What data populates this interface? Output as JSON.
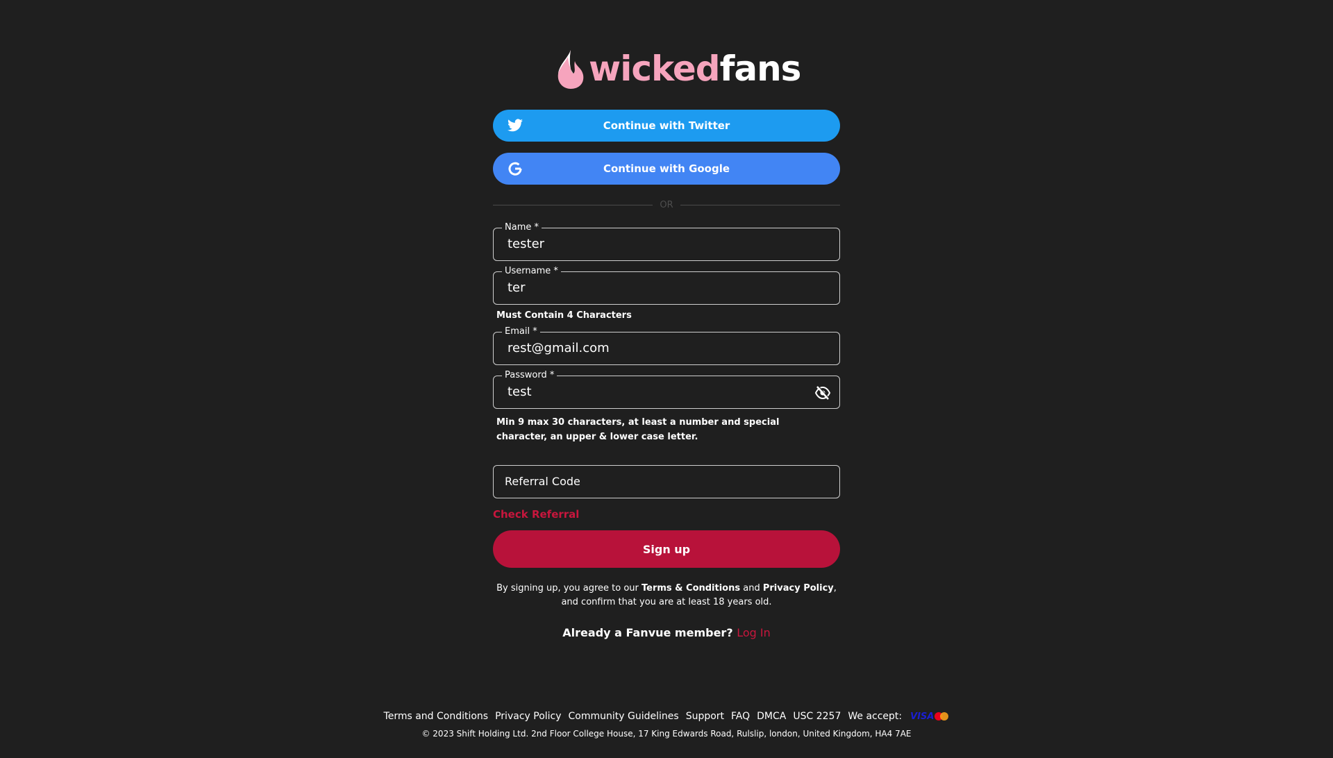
{
  "brand": {
    "name_part1": "wicked",
    "name_part2": "fans",
    "pink": "#f6a4bd"
  },
  "social": {
    "twitter_label": "Continue with Twitter",
    "google_label": "Continue with Google",
    "twitter_color": "#1d9bf0",
    "google_color": "#4285f4"
  },
  "divider_label": "OR",
  "fields": {
    "name": {
      "label": "Name *",
      "value": "tester"
    },
    "username": {
      "label": "Username *",
      "value": "ter",
      "helper": "Must Contain 4 Characters"
    },
    "email": {
      "label": "Email *",
      "value": "rest@gmail.com"
    },
    "password": {
      "label": "Password *",
      "value": "test",
      "helper": "Min 9 max 30 characters, at least a number and special character, an upper & lower case letter."
    },
    "referral": {
      "placeholder": "Referral Code"
    }
  },
  "check_referral": "Check Referral",
  "signup_label": "Sign up",
  "terms": {
    "prefix": "By signing up, you agree to our ",
    "terms_link": "Terms & Conditions",
    "and": " and ",
    "privacy_link": "Privacy Policy",
    "suffix": ", and confirm that you are at least 18 years old."
  },
  "already": {
    "text": "Already a Fanvue member?",
    "login": "Log In"
  },
  "footer": {
    "links": [
      "Terms and Conditions",
      "Privacy Policy",
      "Community Guidelines",
      "Support",
      "FAQ",
      "DMCA",
      "USC 2257"
    ],
    "we_accept": "We accept:",
    "visa": "VISA",
    "copyright": "© 2023 Shift Holding Ltd. 2nd Floor College House, 17 King Edwards Road, Rulslip, london, United Kingdom, HA4 7AE"
  },
  "colors": {
    "accent": "#b8123a",
    "link": "#c8163d",
    "background": "#1f1f1f"
  }
}
